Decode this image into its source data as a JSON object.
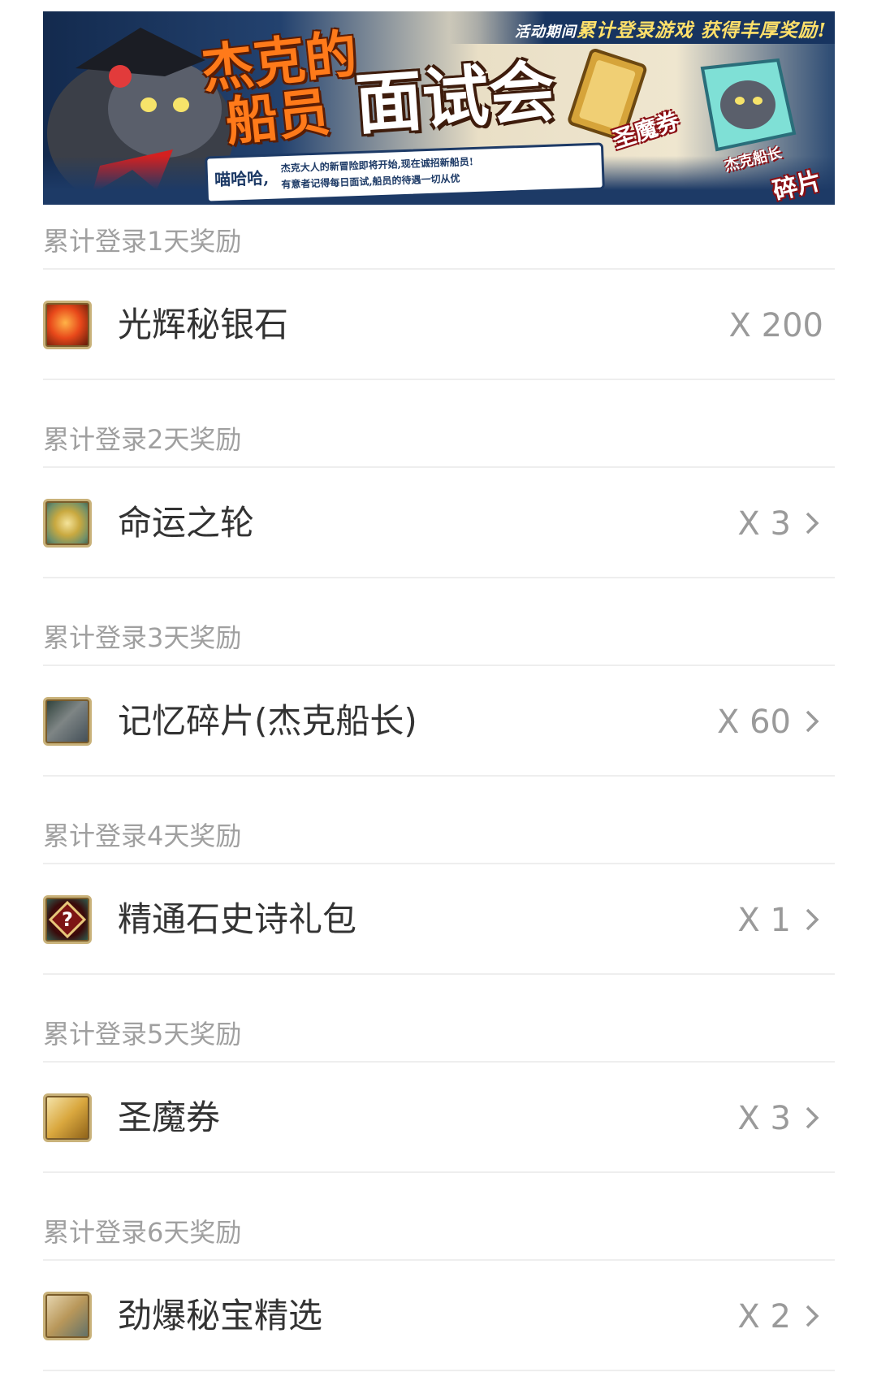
{
  "banner": {
    "top_text_prefix": "活动期间",
    "top_text": "累计登录游戏 获得丰厚奖励!",
    "title_line1": "杰克的",
    "title_line2": "船员",
    "title_main": "面试会",
    "bubble_prefix": "喵哈哈,",
    "bubble_line1": "杰克大人的新冒险即将开始,现在诚招新船员!",
    "bubble_line2": "有意者记得每日面试,船员的待遇一切从优",
    "ticket_label": "圣魔券",
    "shard_label_1": "杰克船长",
    "shard_label_2": "碎片"
  },
  "rewards": [
    {
      "day_label": "累计登录1天奖励",
      "item_name": "光辉秘银石",
      "quantity": "X 200",
      "icon": "mithril-stone-icon",
      "has_arrow": false
    },
    {
      "day_label": "累计登录2天奖励",
      "item_name": "命运之轮",
      "quantity": "X 3",
      "icon": "wheel-of-fate-icon",
      "has_arrow": true
    },
    {
      "day_label": "累计登录3天奖励",
      "item_name": "记忆碎片(杰克船长)",
      "quantity": "X 60",
      "icon": "memory-shard-icon",
      "has_arrow": true
    },
    {
      "day_label": "累计登录4天奖励",
      "item_name": "精通石史诗礼包",
      "quantity": "X 1",
      "icon": "epic-pack-icon",
      "has_arrow": true
    },
    {
      "day_label": "累计登录5天奖励",
      "item_name": "圣魔券",
      "quantity": "X 3",
      "icon": "holy-demon-ticket-icon",
      "has_arrow": true
    },
    {
      "day_label": "累计登录6天奖励",
      "item_name": "劲爆秘宝精选",
      "quantity": "X 2",
      "icon": "treasure-chest-icon",
      "has_arrow": true
    }
  ]
}
